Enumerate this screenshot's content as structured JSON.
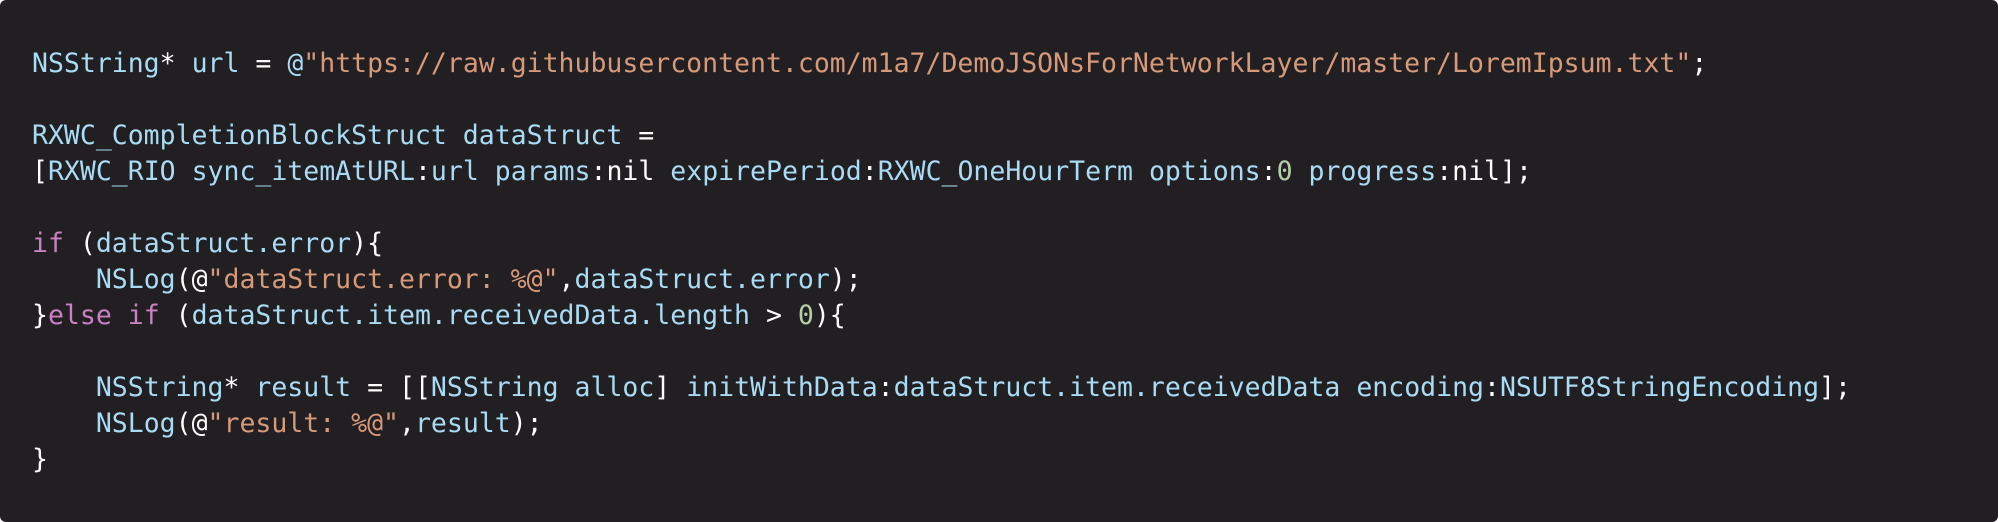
{
  "colors": {
    "background": "#221f22",
    "plain": "#fcfcfa",
    "identifier": "#a9dcf4",
    "string": "#d69a7a",
    "keyword": "#cb80c4",
    "number": "#b5cea8"
  },
  "code": {
    "lines": [
      [
        {
          "t": "NSString",
          "c": "identifier"
        },
        {
          "t": "* ",
          "c": "plain"
        },
        {
          "t": "url",
          "c": "identifier"
        },
        {
          "t": " = ",
          "c": "plain"
        },
        {
          "t": "@",
          "c": "identifier"
        },
        {
          "t": "\"https://raw.githubusercontent.com/m1a7/DemoJSONsForNetworkLayer/master/LoremIpsum.txt\"",
          "c": "string"
        },
        {
          "t": ";",
          "c": "plain"
        }
      ],
      [],
      [
        {
          "t": "RXWC_CompletionBlockStruct",
          "c": "identifier"
        },
        {
          "t": " ",
          "c": "plain"
        },
        {
          "t": "dataStruct",
          "c": "identifier"
        },
        {
          "t": " =",
          "c": "plain"
        }
      ],
      [
        {
          "t": "[",
          "c": "plain"
        },
        {
          "t": "RXWC_RIO",
          "c": "identifier"
        },
        {
          "t": " ",
          "c": "plain"
        },
        {
          "t": "sync_itemAtURL",
          "c": "identifier"
        },
        {
          "t": ":",
          "c": "plain"
        },
        {
          "t": "url",
          "c": "identifier"
        },
        {
          "t": " ",
          "c": "plain"
        },
        {
          "t": "params",
          "c": "identifier"
        },
        {
          "t": ":nil ",
          "c": "plain"
        },
        {
          "t": "expirePeriod",
          "c": "identifier"
        },
        {
          "t": ":",
          "c": "plain"
        },
        {
          "t": "RXWC_OneHourTerm",
          "c": "identifier"
        },
        {
          "t": " ",
          "c": "plain"
        },
        {
          "t": "options",
          "c": "identifier"
        },
        {
          "t": ":",
          "c": "plain"
        },
        {
          "t": "0",
          "c": "number"
        },
        {
          "t": " ",
          "c": "plain"
        },
        {
          "t": "progress",
          "c": "identifier"
        },
        {
          "t": ":nil];",
          "c": "plain"
        }
      ],
      [],
      [
        {
          "t": "if",
          "c": "keyword"
        },
        {
          "t": " (",
          "c": "plain"
        },
        {
          "t": "dataStruct.error",
          "c": "identifier"
        },
        {
          "t": "){",
          "c": "plain"
        }
      ],
      [
        {
          "t": "    ",
          "c": "plain"
        },
        {
          "t": "NSLog",
          "c": "identifier"
        },
        {
          "t": "(@",
          "c": "plain"
        },
        {
          "t": "\"dataStruct.error: %@\"",
          "c": "string"
        },
        {
          "t": ",",
          "c": "plain"
        },
        {
          "t": "dataStruct.error",
          "c": "identifier"
        },
        {
          "t": ");",
          "c": "plain"
        }
      ],
      [
        {
          "t": "}",
          "c": "plain"
        },
        {
          "t": "else if",
          "c": "keyword"
        },
        {
          "t": " (",
          "c": "plain"
        },
        {
          "t": "dataStruct.item.receivedData.length",
          "c": "identifier"
        },
        {
          "t": " > ",
          "c": "plain"
        },
        {
          "t": "0",
          "c": "number"
        },
        {
          "t": "){",
          "c": "plain"
        }
      ],
      [],
      [
        {
          "t": "    ",
          "c": "plain"
        },
        {
          "t": "NSString",
          "c": "identifier"
        },
        {
          "t": "* ",
          "c": "plain"
        },
        {
          "t": "result",
          "c": "identifier"
        },
        {
          "t": " = [[",
          "c": "plain"
        },
        {
          "t": "NSString",
          "c": "identifier"
        },
        {
          "t": " ",
          "c": "plain"
        },
        {
          "t": "alloc",
          "c": "identifier"
        },
        {
          "t": "] ",
          "c": "plain"
        },
        {
          "t": "initWithData",
          "c": "identifier"
        },
        {
          "t": ":",
          "c": "plain"
        },
        {
          "t": "dataStruct.item.receivedData",
          "c": "identifier"
        },
        {
          "t": " ",
          "c": "plain"
        },
        {
          "t": "encoding",
          "c": "identifier"
        },
        {
          "t": ":",
          "c": "plain"
        },
        {
          "t": "NSUTF8StringEncoding",
          "c": "identifier"
        },
        {
          "t": "];",
          "c": "plain"
        }
      ],
      [
        {
          "t": "    ",
          "c": "plain"
        },
        {
          "t": "NSLog",
          "c": "identifier"
        },
        {
          "t": "(@",
          "c": "plain"
        },
        {
          "t": "\"result: %@\"",
          "c": "string"
        },
        {
          "t": ",",
          "c": "plain"
        },
        {
          "t": "result",
          "c": "identifier"
        },
        {
          "t": ");",
          "c": "plain"
        }
      ],
      [
        {
          "t": "}",
          "c": "plain"
        }
      ]
    ]
  }
}
